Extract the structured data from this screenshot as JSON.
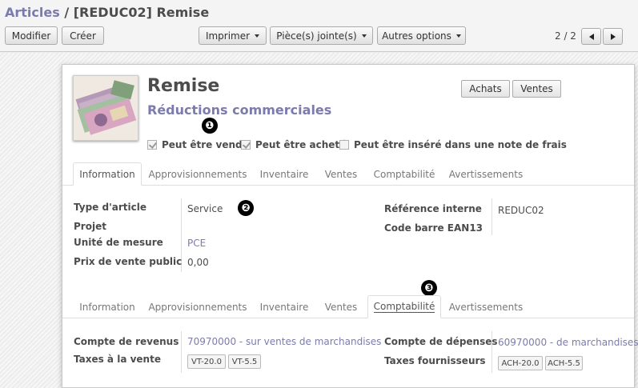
{
  "breadcrumb": {
    "parent": "Articles",
    "separator": " / ",
    "current": "[REDUC02] Remise"
  },
  "toolbar": {
    "edit_label": "Modifier",
    "create_label": "Créer",
    "print_label": "Imprimer",
    "attachments_label": "Pièce(s) jointe(s)",
    "more_label": "Autres options",
    "pager": "2 / 2"
  },
  "product": {
    "name": "Remise",
    "category": "Réductions commerciales",
    "purchases_button": "Achats",
    "sales_button": "Ventes",
    "options": [
      {
        "label": "Peut être vendu",
        "checked": true
      },
      {
        "label": "Peut être acheté",
        "checked": true
      },
      {
        "label": "Peut être inséré dans une note de frais",
        "checked": false
      }
    ]
  },
  "callouts": [
    "❶",
    "❷",
    "❸"
  ],
  "tabs": [
    "Information",
    "Approvisionnements",
    "Inventaire",
    "Ventes",
    "Comptabilité",
    "Avertissements"
  ],
  "information": {
    "type_label": "Type d'article",
    "type_value": "Service",
    "project_label": "Projet",
    "uom_label": "Unité de mesure",
    "uom_value": "PCE",
    "price_label": "Prix de vente public",
    "price_value": "0,00",
    "ref_label": "Référence interne",
    "ref_value": "REDUC02",
    "ean_label": "Code barre EAN13"
  },
  "accounting": {
    "income_label": "Compte de revenus",
    "income_value": "70970000 - sur ventes de marchandises",
    "sale_taxes_label": "Taxes à la vente",
    "sale_taxes": [
      "VT-20.0",
      "VT-5.5"
    ],
    "expense_label": "Compte de dépenses",
    "expense_value": "60970000 - de marchandises",
    "supplier_taxes_label": "Taxes fournisseurs",
    "supplier_taxes": [
      "ACH-20.0",
      "ACH-5.5"
    ]
  },
  "colors": {
    "link": "#7c7bad",
    "text": "#4c4c4c"
  }
}
